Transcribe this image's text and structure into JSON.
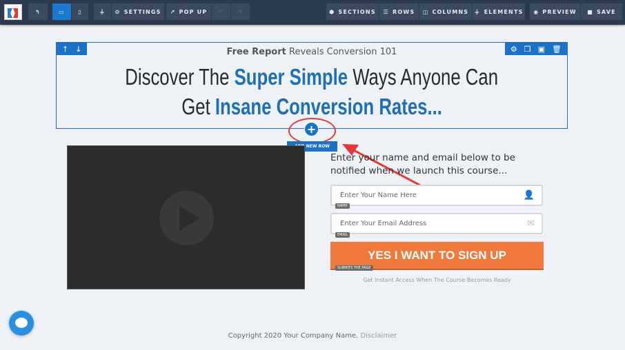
{
  "toolbar": {
    "settings": "SETTINGS",
    "popup": "POP UP",
    "sections": "SECTIONS",
    "rows": "ROWS",
    "columns": "COLUMNS",
    "elements": "ELEMENTS",
    "preview": "PREVIEW",
    "save": "SAVE",
    "active_view": "desktop"
  },
  "section": {
    "subheading_bold": "Free Report",
    "subheading_rest": " Reveals Conversion 101",
    "headline_line1_a": "Discover The ",
    "headline_line1_b": "Super Simple",
    "headline_line1_c": " Ways Anyone Can",
    "headline_line2_a": "Get ",
    "headline_line2_b": "Insane Conversion Rates..."
  },
  "add_row": {
    "plus": "+",
    "label": "ADD NEW ROW"
  },
  "form": {
    "intro": "Enter your name and email below to be notified when we launch this course...",
    "name_placeholder": "Enter Your Name Here",
    "name_tag": "NAME",
    "email_placeholder": "Enter Your Email Address",
    "email_tag": "EMAIL",
    "cta": "YES I WANT TO SIGN UP",
    "cta_tag": "SUBMITS THE PAGE",
    "note": "Get Instant Access When The Course Becomes Ready"
  },
  "footer": {
    "copyright": "Copyright 2020 Your Company Name. ",
    "disclaimer": "Disclaimer"
  },
  "colors": {
    "accent": "#1a72c9",
    "cta": "#f07a3c",
    "annotation": "#e53935"
  }
}
